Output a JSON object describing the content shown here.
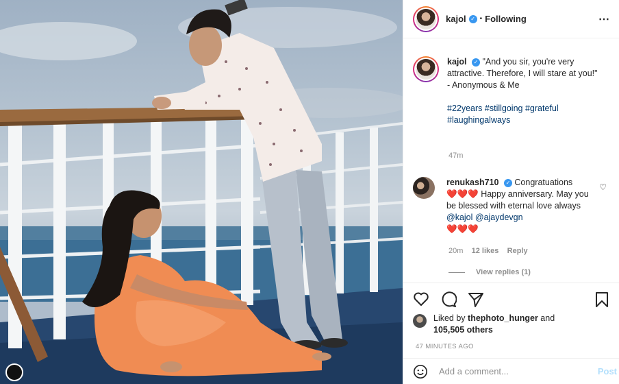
{
  "post": {
    "author": "kajol",
    "verified": true,
    "follow_status": "Following",
    "more_icon": "more-horizontal-icon"
  },
  "caption": {
    "author": "kajol",
    "text_line1": "\"And you sir, you're very attractive. Therefore, I will stare at you!\"",
    "text_line2": "- Anonymous & Me",
    "hashtags": "#22years #stillgoing #grateful #laughingalways",
    "time": "47m"
  },
  "comment": {
    "author": "renukash710",
    "verified": true,
    "text_a": "Congratuations",
    "text_b": "Happy anniversary. May you be blessed with eternal love always",
    "mention1": "@kajol",
    "mention2": "@ajaydevgn",
    "hearts_inline": "❤️❤️❤️",
    "hearts_end": "❤️❤️❤️",
    "time": "20m",
    "likes": "12 likes",
    "reply_label": "Reply",
    "view_replies": "View replies (1)"
  },
  "likes": {
    "prefix": "Liked by",
    "user": "thephoto_hunger",
    "and": "and",
    "count": "105,505 others"
  },
  "posted_ago": "47 MINUTES AGO",
  "add_comment": {
    "placeholder": "Add a comment...",
    "post_label": "Post"
  },
  "colors": {
    "link": "#00376b",
    "verified": "#3897f0",
    "post_disabled": "#b2dffc",
    "heart": "#e0245e"
  }
}
